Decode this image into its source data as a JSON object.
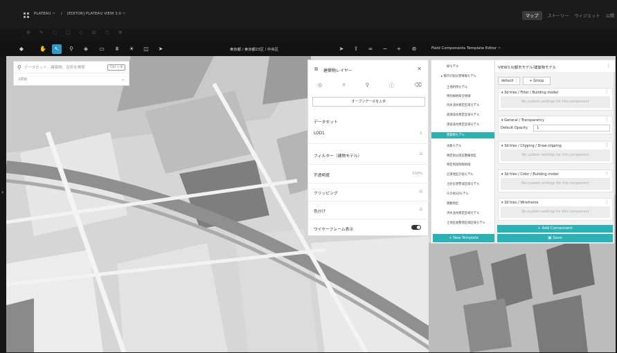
{
  "header": {
    "project": "PLATEAU ~",
    "separator": "/",
    "project_title": "[EDITOR] PLATEAU VIEW 3.0 ~",
    "modes": [
      "マップ",
      "ストーリー",
      "ウィジェット",
      "公開"
    ],
    "active_mode": "マップ"
  },
  "toolbar": {
    "location": "東京都 / 東京都23区 / 中央区",
    "editor_title": "Field Components Template Editor ~"
  },
  "search": {
    "placeholder": "データセット、建築物、住所を検索",
    "shortcut": "Ctrl + K",
    "selected_count": "2項目"
  },
  "layer_panel": {
    "title": "建築物レイヤー",
    "open_data_button": "オープンデータを入手",
    "dataset_label": "データセット",
    "dataset_value": "LOD1",
    "filter_label": "フィルター（建物モデル）",
    "opacity_label": "不透明度",
    "opacity_value": "100%",
    "clipping_label": "クリッピング",
    "color_label": "色分け",
    "wireframe_label": "ワイヤーフレーム表示"
  },
  "template_list": {
    "items": [
      "緑モデル",
      "▸ 都市計画災害情報モデル",
      "土地利用モデル",
      "特別緑地保全地域",
      "内水浸水想定区域モデル",
      "高潮浸水想定区域モデル",
      "津波浸水想定区域モデル",
      "建築物モデル",
      "水路モデル",
      "特定防災街区整備地区",
      "特定用途制限地域",
      "沿道地区計画モデル",
      "土砂災害警戒区域モデル",
      "その他3Dモデル",
      "景観地区",
      "洪水浸水想定区域モデル",
      "土地区画整理区域区域モデル"
    ],
    "selected": "建築物モデル",
    "new_template": "+ New Template"
  },
  "editor": {
    "path": "VIEW3.0/都市モデル/建築物モデル",
    "default_tag": "default",
    "group_button": "+ Group",
    "sections": [
      {
        "title": "▾ 3d tiles / Filter / Building model",
        "body": "No custom settings for this component"
      },
      {
        "title": "▾ General / Transparency",
        "field_label": "Default Opacity",
        "field_value": "1"
      },
      {
        "title": "▾ 3d tiles / Clipping / Draw clipping",
        "body": "No custom settings for this component"
      },
      {
        "title": "▾ 3d tiles / Color / Building model",
        "body": "No custom settings for this component"
      },
      {
        "title": "▾ 3d tiles / Wireframe",
        "body": "No custom settings for this component"
      }
    ],
    "add_component": "+ Add Component",
    "save": "Save"
  }
}
